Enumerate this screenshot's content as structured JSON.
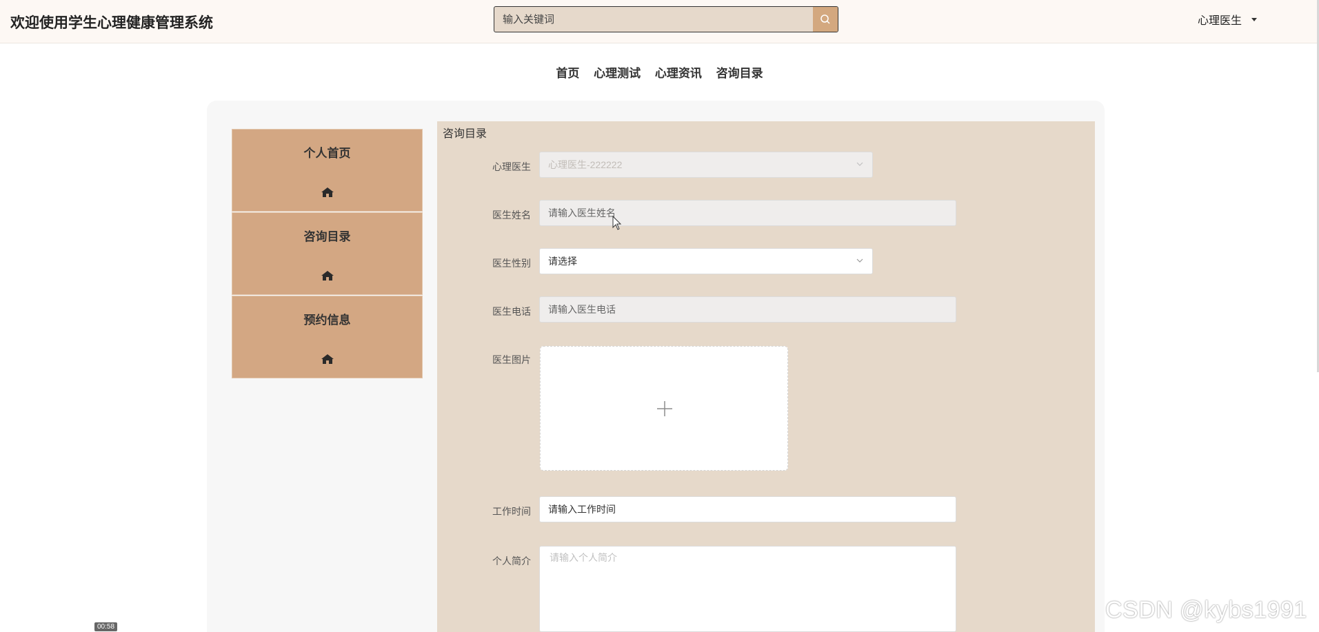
{
  "header": {
    "title": "欢迎使用学生心理健康管理系统",
    "search_placeholder": "输入关键词",
    "user_label": "心理医生"
  },
  "nav": {
    "items": [
      "首页",
      "心理测试",
      "心理资讯",
      "咨询目录"
    ]
  },
  "sidebar": {
    "items": [
      {
        "label": "个人首页",
        "icon": "home-icon"
      },
      {
        "label": "咨询目录",
        "icon": "home-icon"
      },
      {
        "label": "预约信息",
        "icon": "home-icon"
      }
    ]
  },
  "form": {
    "section_title": "咨询目录",
    "fields": [
      {
        "label": "心理医生",
        "value": "心理医生-222222",
        "state": "disabled"
      },
      {
        "label": "医生姓名",
        "value": "请输入医生姓名",
        "state": "readonly"
      },
      {
        "label": "医生性别",
        "value": "请选择",
        "state": "select"
      },
      {
        "label": "医生电话",
        "value": "请输入医生电话",
        "state": "readonly"
      },
      {
        "label": "医生图片"
      },
      {
        "label": "工作时间",
        "value": "请输入工作时间",
        "state": "editable"
      },
      {
        "label": "个人简介",
        "placeholder": "请输入个人简介"
      }
    ]
  },
  "overlay": {
    "timestamp": "00:58",
    "watermark": "CSDN @kybs1991"
  },
  "colors": {
    "accent": "#d3a783",
    "content_bg": "#e6d9ca",
    "header_bg": "#fdf8f4"
  }
}
